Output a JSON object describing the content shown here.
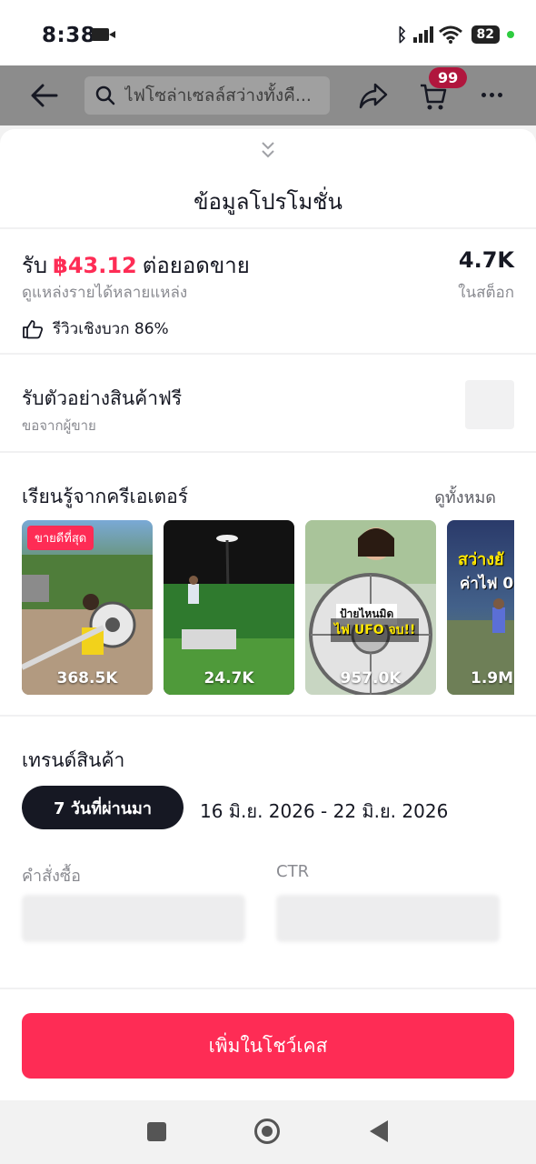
{
  "status_bar": {
    "time": "8:38",
    "battery": "82"
  },
  "header": {
    "search_text": "ไฟโซล่าเซลล์สว่างทั้งคื...",
    "cart_badge": "99"
  },
  "sheet": {
    "title": "ข้อมูลโปรโมชั่น",
    "earn": {
      "prefix": "รับ",
      "amount": "฿43.12",
      "suffix": "ต่อยอดขาย",
      "sub": "ดูแหล่งรายได้หลายแหล่ง"
    },
    "stock": {
      "value": "4.7K",
      "label": "ในสต็อก"
    },
    "review": {
      "label": "รีวิวเชิงบวก 86%"
    },
    "sample": {
      "title": "รับตัวอย่างสินค้าฟรี",
      "sub": "ขอจากผู้ขาย"
    },
    "learn": {
      "title": "เรียนรู้จากครีเอเตอร์",
      "see_all": "ดูทั้งหมด",
      "videos": [
        {
          "views": "368.5K",
          "badge": "ขายดีที่สุด"
        },
        {
          "views": "24.7K"
        },
        {
          "views": "957.0K",
          "overlay_top": "ป้ายไหนมิด",
          "overlay_bottom": "ไฟ UFO จบ!!"
        },
        {
          "views": "1.9M",
          "overlay_top": "สว่างยั",
          "overlay_bottom": "ค่าไฟ 0"
        }
      ]
    },
    "trend": {
      "title": "เทรนด์สินค้า",
      "period": "7 วันที่ผ่านมา",
      "date_range": "16 มิ.ย. 2026 - 22 มิ.ย. 2026",
      "metrics": [
        {
          "label": "คำสั่งซื้อ"
        },
        {
          "label": "CTR"
        }
      ]
    },
    "cta_label": "เพิ่มในโชว์เคส"
  },
  "colors": {
    "accent": "#fe2c55",
    "text": "#161823",
    "muted": "#8a8b91"
  }
}
